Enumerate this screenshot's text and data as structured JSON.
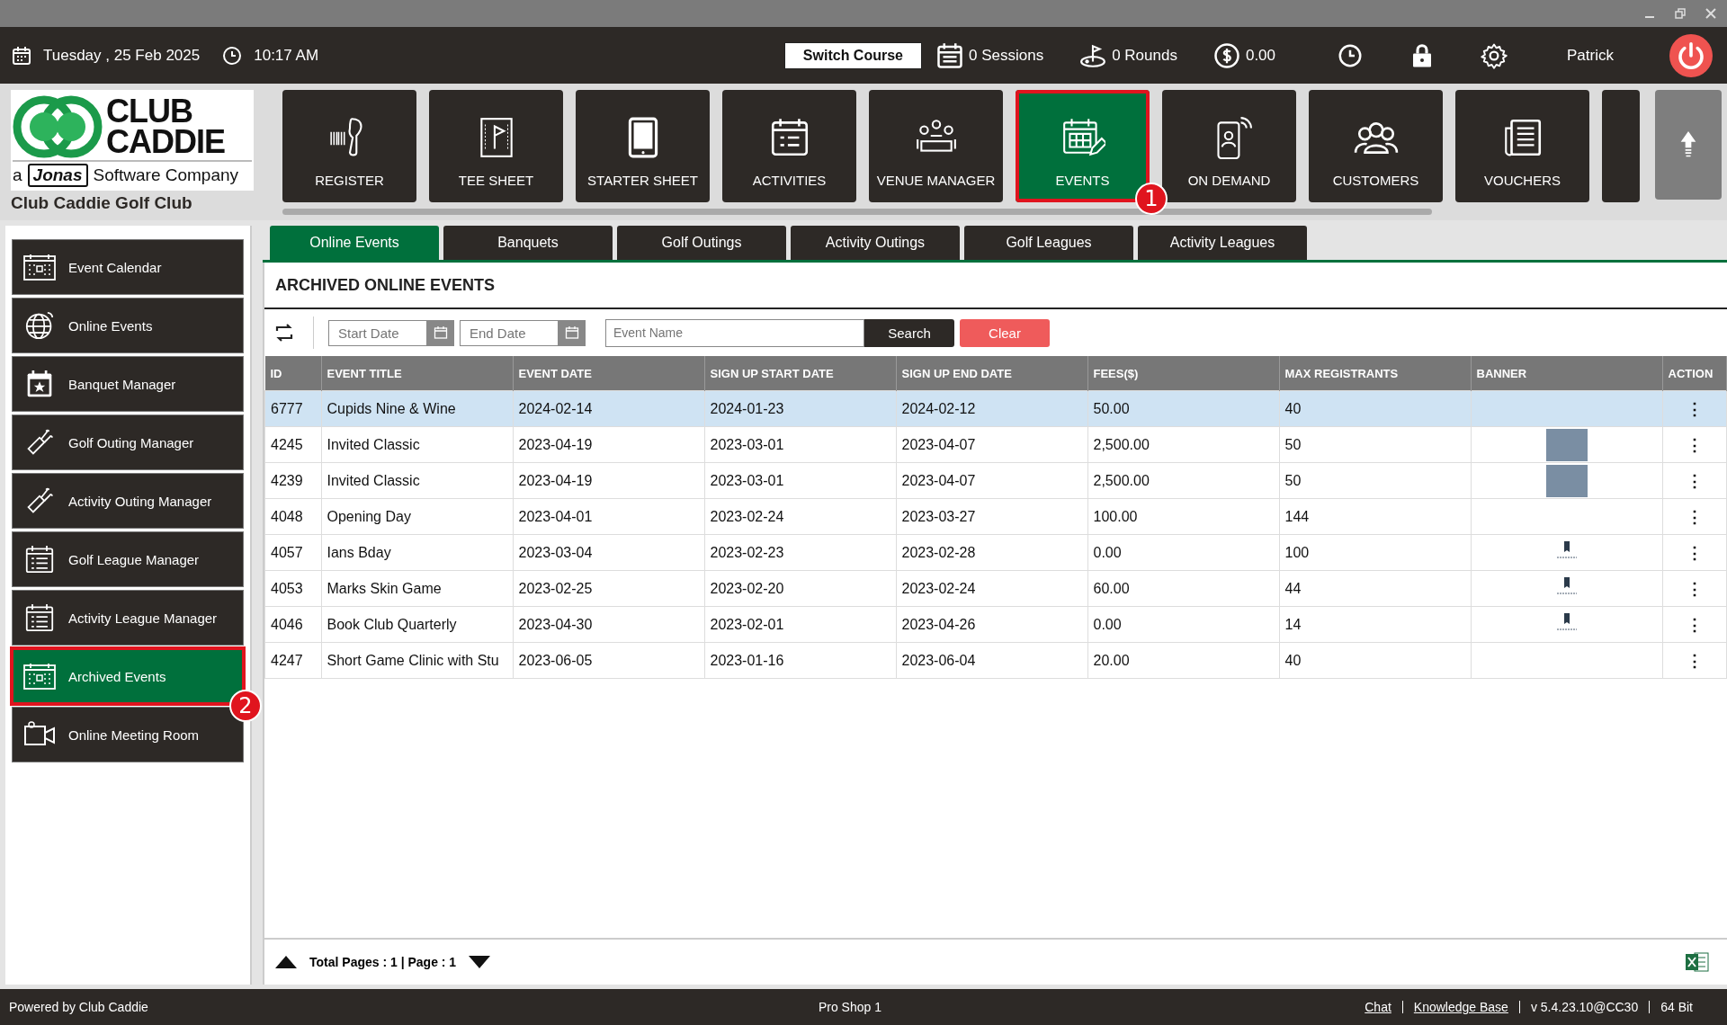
{
  "topbar": {
    "date": "Tuesday ,  25 Feb 2025",
    "time": "10:17 AM",
    "switch_course": "Switch Course",
    "sessions": "0 Sessions",
    "rounds": "0 Rounds",
    "balance": "0.00",
    "user": "Patrick"
  },
  "brand": {
    "logo_line1": "CLUB",
    "logo_line2": "CADDIE",
    "logo_prefix": "a",
    "logo_company": "Jonas",
    "logo_suffix": "Software Company",
    "club_name": "Club Caddie Golf Club"
  },
  "nav": [
    {
      "label": "REGISTER",
      "selected": false
    },
    {
      "label": "TEE SHEET",
      "selected": false
    },
    {
      "label": "STARTER SHEET",
      "selected": false
    },
    {
      "label": "ACTIVITIES",
      "selected": false
    },
    {
      "label": "VENUE MANAGER",
      "selected": false
    },
    {
      "label": "EVENTS",
      "selected": true,
      "callout": "1"
    },
    {
      "label": "ON DEMAND",
      "selected": false
    },
    {
      "label": "CUSTOMERS",
      "selected": false
    },
    {
      "label": "VOUCHERS",
      "selected": false
    }
  ],
  "sidebar": {
    "items": [
      {
        "label": "Event Calendar",
        "selected": false
      },
      {
        "label": "Online Events",
        "selected": false
      },
      {
        "label": "Banquet Manager",
        "selected": false
      },
      {
        "label": "Golf Outing Manager",
        "selected": false
      },
      {
        "label": "Activity Outing Manager",
        "selected": false
      },
      {
        "label": "Golf League Manager",
        "selected": false
      },
      {
        "label": "Activity League Manager",
        "selected": false
      },
      {
        "label": "Archived Events",
        "selected": true,
        "callout": "2"
      },
      {
        "label": "Online Meeting Room",
        "selected": false
      }
    ]
  },
  "tabs": [
    {
      "label": "Online Events",
      "selected": true
    },
    {
      "label": "Banquets",
      "selected": false
    },
    {
      "label": "Golf Outings",
      "selected": false
    },
    {
      "label": "Activity Outings",
      "selected": false
    },
    {
      "label": "Golf Leagues",
      "selected": false
    },
    {
      "label": "Activity Leagues",
      "selected": false
    }
  ],
  "section_title": "ARCHIVED ONLINE EVENTS",
  "filters": {
    "start_date": {
      "placeholder": "Start Date"
    },
    "end_date": {
      "placeholder": "End Date"
    },
    "event_name": {
      "placeholder": "Event Name"
    },
    "search": "Search",
    "clear": "Clear"
  },
  "table": {
    "columns": [
      "ID",
      "EVENT TITLE",
      "EVENT DATE",
      "SIGN UP START DATE",
      "SIGN UP END DATE",
      "FEES($)",
      "MAX REGISTRANTS",
      "BANNER",
      "ACTION"
    ],
    "rows": [
      {
        "cells": [
          "6777",
          "Cupids Nine & Wine",
          "2024-02-14",
          "2024-01-23",
          "2024-02-12",
          "50.00",
          "40"
        ],
        "kind": "plain",
        "action": "⋮",
        "selected": true
      },
      {
        "cells": [
          "4245",
          "Invited Classic",
          "2023-04-19",
          "2023-03-01",
          "2023-04-07",
          "2,500.00",
          "50"
        ],
        "kind": "photo",
        "action": "⋮",
        "selected": false
      },
      {
        "cells": [
          "4239",
          "Invited Classic",
          "2023-04-19",
          "2023-03-01",
          "2023-04-07",
          "2,500.00",
          "50"
        ],
        "kind": "photo",
        "action": "⋮",
        "selected": false
      },
      {
        "cells": [
          "4048",
          "Opening Day",
          "2023-04-01",
          "2023-02-24",
          "2023-03-27",
          "100.00",
          "144"
        ],
        "kind": "plain",
        "action": "⋮",
        "selected": false
      },
      {
        "cells": [
          "4057",
          "Ians Bday",
          "2023-03-04",
          "2023-02-23",
          "2023-02-28",
          "0.00",
          "100"
        ],
        "kind": "logo",
        "action": "⋮",
        "selected": false
      },
      {
        "cells": [
          "4053",
          "Marks Skin Game",
          "2023-02-25",
          "2023-02-20",
          "2023-02-24",
          "60.00",
          "44"
        ],
        "kind": "logo",
        "action": "⋮",
        "selected": false
      },
      {
        "cells": [
          "4046",
          "Book Club Quarterly",
          "2023-04-30",
          "2023-02-01",
          "2023-04-26",
          "0.00",
          "14"
        ],
        "kind": "logo",
        "action": "⋮",
        "selected": false
      },
      {
        "cells": [
          "4247",
          "Short Game Clinic with Stu",
          "2023-06-05",
          "2023-01-16",
          "2023-06-04",
          "20.00",
          "40"
        ],
        "kind": "plain",
        "action": "⋮",
        "selected": false
      }
    ]
  },
  "pagination": "Total Pages : 1 | Page : 1",
  "status_bar": {
    "left": "Powered by Club Caddie",
    "center": "Pro Shop 1",
    "links": [
      "Chat",
      "Knowledge Base"
    ],
    "version": "v 5.4.23.10@CC30",
    "bits": "64 Bit"
  }
}
